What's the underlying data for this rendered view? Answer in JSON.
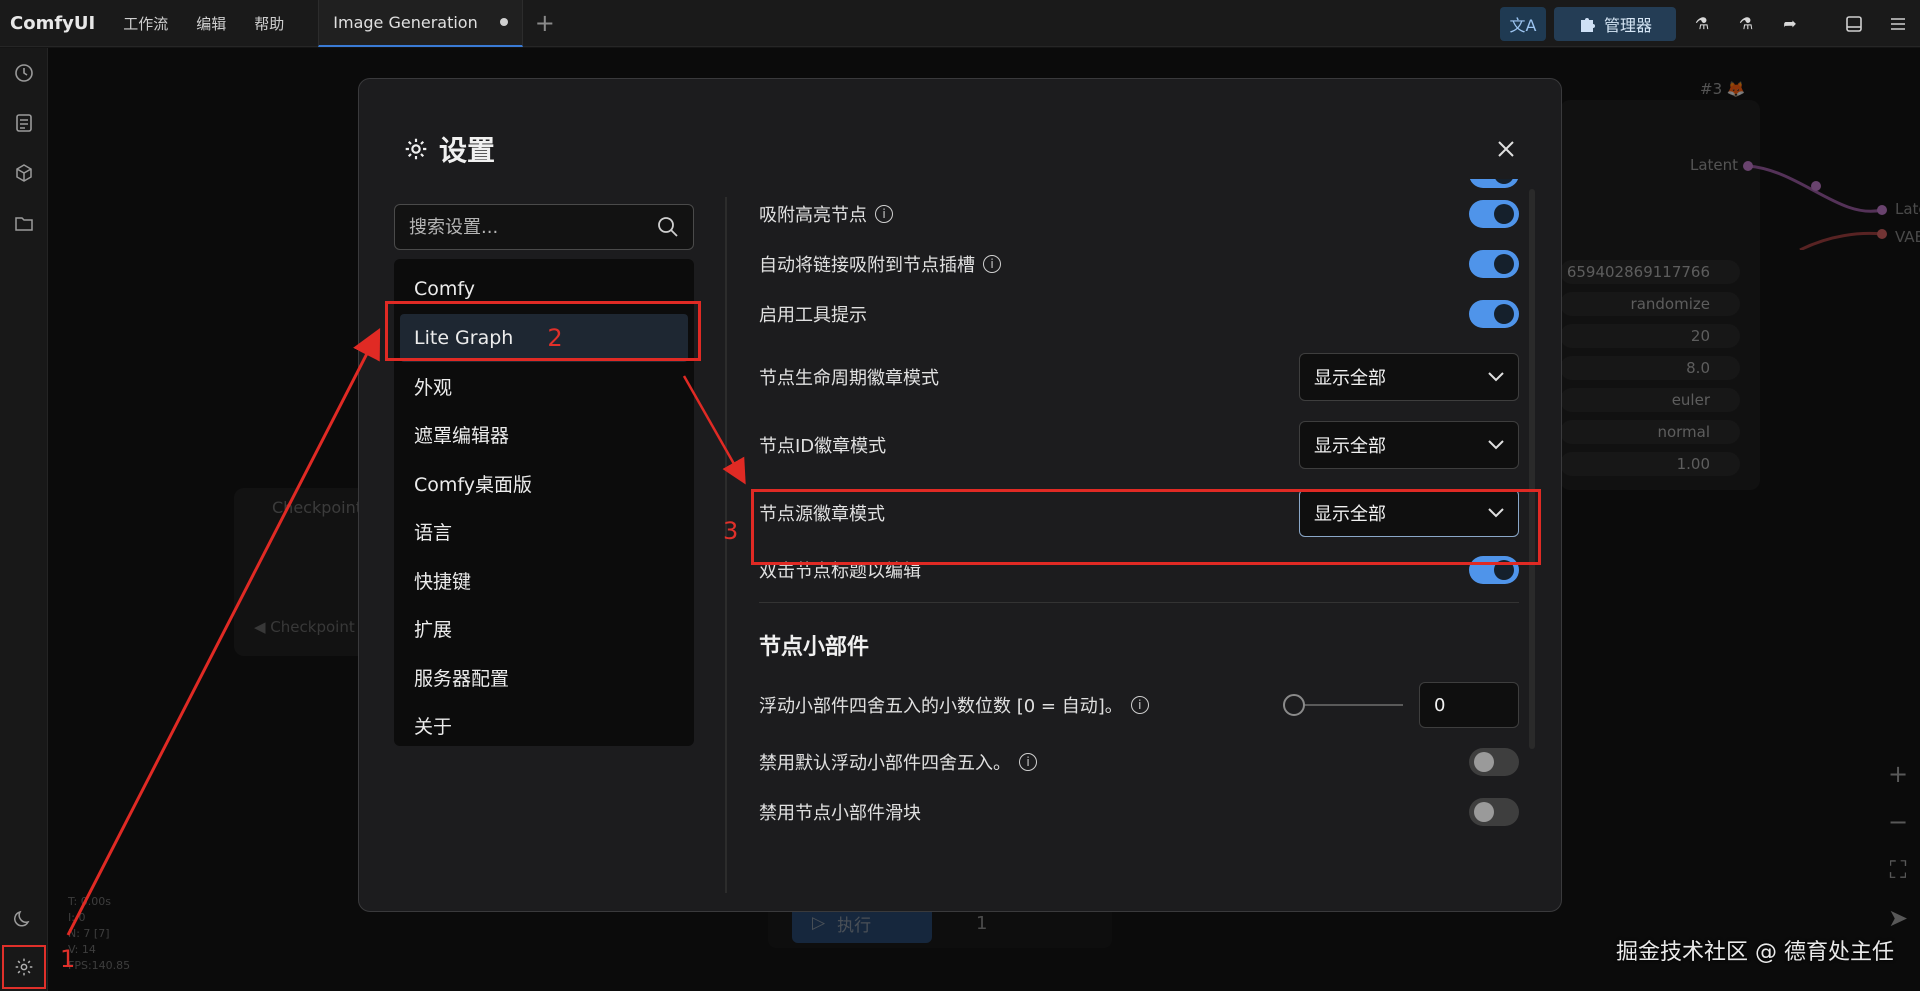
{
  "app": {
    "logo": "ComfyUI"
  },
  "menu": [
    "工作流",
    "编辑",
    "帮助"
  ],
  "tab": {
    "label": "Image Generation"
  },
  "topbar": {
    "manager_label": "管理器"
  },
  "canvas": {
    "checkpoint_title": "Checkpoint",
    "checkpoint_widget": "◀ Checkpoint",
    "node_id": "#3 🦊",
    "port_latent": "Latent",
    "port_late": "Late",
    "port_vae": "VAE",
    "seed_value": "659402869117766",
    "control": "randomize",
    "steps": "20",
    "cfg": "8.0",
    "sampler": "euler",
    "scheduler": "normal",
    "denoise": "1.00",
    "stats": [
      "T: 0.00s",
      "I: 0",
      "N: 7 [7]",
      "V: 14",
      "FPS:140.85"
    ],
    "exec_label": "执行",
    "exec_count": "1"
  },
  "dialog": {
    "title": "设置",
    "search_placeholder": "搜索设置...",
    "categories": [
      "Comfy",
      "Lite Graph",
      "外观",
      "遮罩编辑器",
      "Comfy桌面版",
      "语言",
      "快捷键",
      "扩展",
      "服务器配置",
      "关于"
    ],
    "settings": [
      {
        "label": "吸附高亮节点",
        "info": true,
        "type": "toggle",
        "value": true
      },
      {
        "label": "自动将链接吸附到节点插槽",
        "info": true,
        "type": "toggle",
        "value": true
      },
      {
        "label": "启用工具提示",
        "info": false,
        "type": "toggle",
        "value": true
      },
      {
        "label": "节点生命周期徽章模式",
        "type": "select",
        "value": "显示全部"
      },
      {
        "label": "节点ID徽章模式",
        "type": "select",
        "value": "显示全部"
      },
      {
        "label": "节点源徽章模式",
        "type": "select",
        "value": "显示全部"
      },
      {
        "label": "双击节点标题以编辑",
        "info": false,
        "type": "toggle",
        "value": true
      }
    ],
    "section_widgets": "节点小部件",
    "widget_settings": [
      {
        "label": "浮动小部件四舍五入的小数位数 [0 = 自动]。",
        "info": true,
        "type": "slider",
        "value": "0"
      },
      {
        "label": "禁用默认浮动小部件四舍五入。",
        "info": true,
        "type": "toggle",
        "value": false
      },
      {
        "label": "禁用节点小部件滑块",
        "info": false,
        "type": "toggle",
        "value": false
      }
    ]
  },
  "annotations": [
    "1",
    "2",
    "3"
  ],
  "watermark": "掘金技术社区 @ 德育处主任",
  "colors": {
    "accent": "#4f94ea",
    "annotation": "#e0302a",
    "active_category": "#1e2732"
  }
}
